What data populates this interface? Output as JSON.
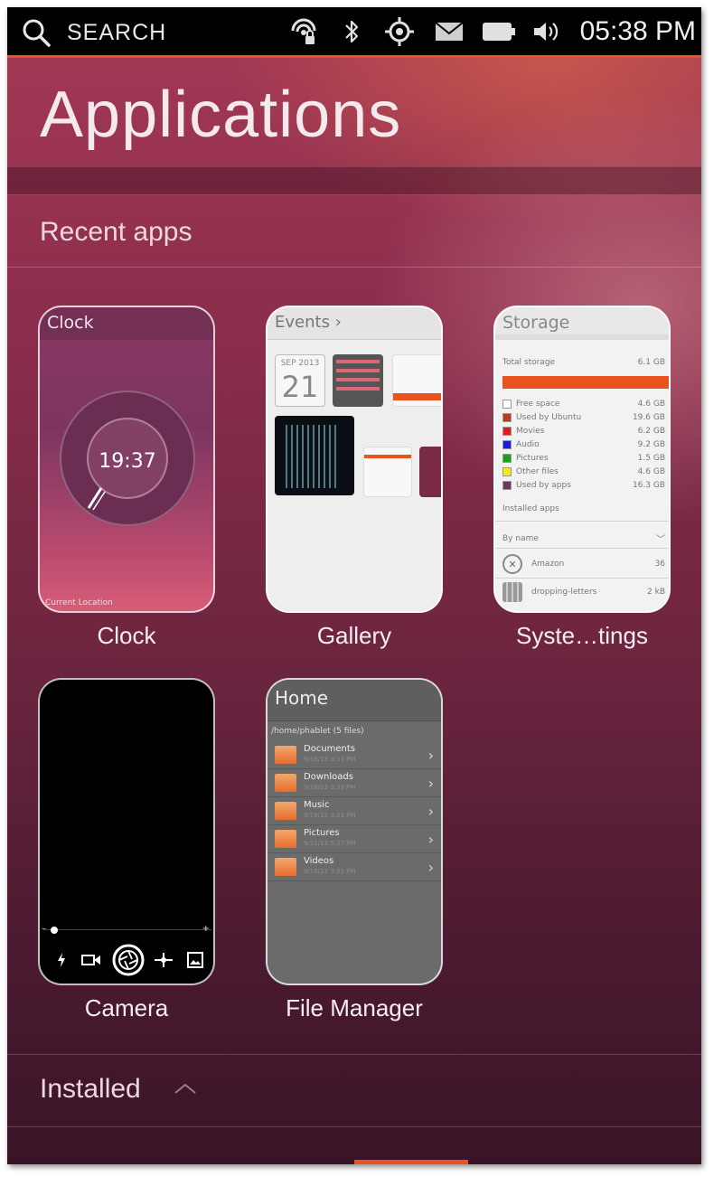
{
  "status_bar": {
    "search_label": "SEARCH",
    "time": "05:38 PM",
    "icons": [
      "network-lock-icon",
      "bluetooth-icon",
      "location-icon",
      "messages-icon",
      "battery-icon",
      "volume-icon"
    ],
    "accent_color": "#e9531f"
  },
  "page": {
    "title": "Applications"
  },
  "recent": {
    "title": "Recent apps",
    "apps": [
      {
        "label": "Clock"
      },
      {
        "label": "Gallery"
      },
      {
        "label": "Syste…tings"
      },
      {
        "label": "Camera"
      },
      {
        "label": "File Manager"
      }
    ]
  },
  "clock_thumb": {
    "header": "Clock",
    "time": "19:37",
    "location": "Current Location"
  },
  "gallery_thumb": {
    "header": "Events ›",
    "calendar_month": "SEP 2013",
    "calendar_day": "21"
  },
  "settings_thumb": {
    "header": "Storage",
    "total_label": "Total storage",
    "total_value": "6.1 GB",
    "items": [
      {
        "label": "Free space",
        "value": "4.6 GB",
        "color": "#ffffff"
      },
      {
        "label": "Used by Ubuntu",
        "value": "19.6 GB",
        "color": "#c0391b"
      },
      {
        "label": "Movies",
        "value": "6.2 GB",
        "color": "#e11d1d"
      },
      {
        "label": "Audio",
        "value": "9.2 GB",
        "color": "#1a1ae0"
      },
      {
        "label": "Pictures",
        "value": "1.5 GB",
        "color": "#13a313"
      },
      {
        "label": "Other files",
        "value": "4.6 GB",
        "color": "#f3ea1b"
      },
      {
        "label": "Used by apps",
        "value": "16.3 GB",
        "color": "#6a3560"
      }
    ],
    "installed_label": "Installed apps",
    "sort_label": "By name",
    "apps": [
      {
        "name": "Amazon",
        "size": "36"
      },
      {
        "name": "dropping-letters",
        "size": "2 kB"
      }
    ]
  },
  "files_thumb": {
    "header": "Home",
    "path": "/home/phablet (5 files)",
    "folders": [
      {
        "name": "Documents",
        "date": "9/18/13 3:33 PM"
      },
      {
        "name": "Downloads",
        "date": "9/18/13 3:33 PM"
      },
      {
        "name": "Music",
        "date": "9/18/13 3:33 PM"
      },
      {
        "name": "Pictures",
        "date": "9/21/13 5:37 PM"
      },
      {
        "name": "Videos",
        "date": "9/18/13 3:33 PM"
      }
    ]
  },
  "installed": {
    "title": "Installed"
  }
}
